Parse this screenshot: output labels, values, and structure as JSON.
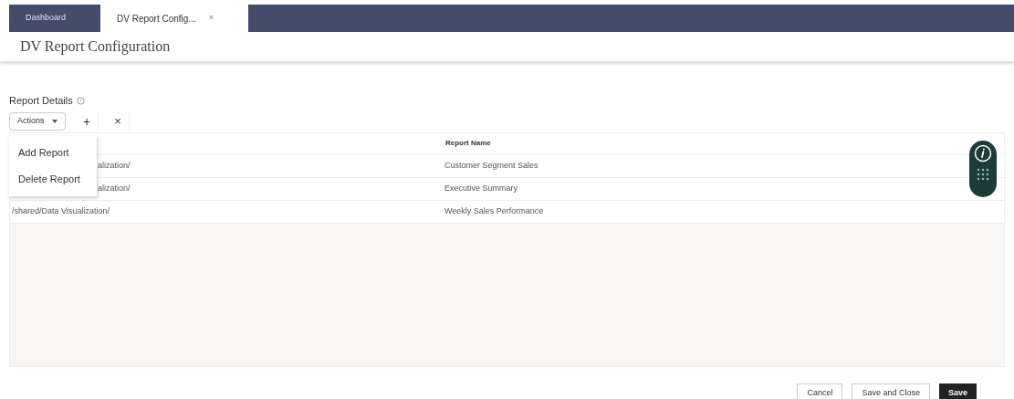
{
  "tabs": [
    {
      "label": "Dashboard",
      "selected": false
    },
    {
      "label": "DV Report Config...",
      "selected": true,
      "close": "×"
    }
  ],
  "page_title": "DV Report Configuration",
  "section": {
    "title": "Report Details"
  },
  "toolbar": {
    "actions_label": "Actions",
    "add": "+",
    "remove": "×"
  },
  "actions_menu": [
    "Add Report",
    "Delete Report"
  ],
  "table": {
    "columns": [
      "Report Name"
    ],
    "rows": [
      {
        "path": "alization/",
        "name": "Customer Segment Sales"
      },
      {
        "path": "alization/",
        "name": "Executive Summary"
      },
      {
        "path": "/shared/Data Visualization/",
        "name": "Weekly Sales Performance"
      }
    ]
  },
  "footer_buttons": [
    {
      "label": "Cancel",
      "kind": "secondary"
    },
    {
      "label": "Save and Close",
      "kind": "secondary"
    },
    {
      "label": "Save",
      "kind": "primary"
    }
  ]
}
